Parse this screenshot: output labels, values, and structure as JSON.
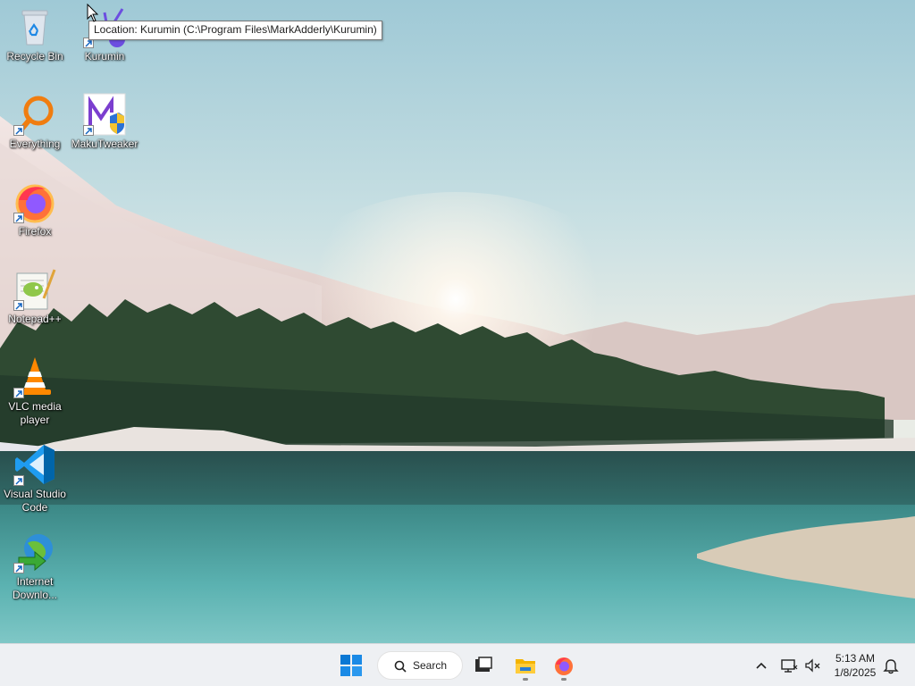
{
  "desktop": {
    "icons": [
      {
        "label": "Recycle Bin",
        "icon": "recycle-bin-icon"
      },
      {
        "label": "Kurumin",
        "icon": "kurumin-icon"
      },
      {
        "label": "Everything",
        "icon": "everything-search-icon"
      },
      {
        "label": "MakuTweaker",
        "icon": "makutweaker-icon"
      },
      {
        "label": "Firefox",
        "icon": "firefox-icon"
      },
      {
        "label": "Notepad++",
        "icon": "notepad-plus-plus-icon"
      },
      {
        "label": "VLC media player",
        "icon": "vlc-icon"
      },
      {
        "label": "Visual Studio Code",
        "icon": "vscode-icon"
      },
      {
        "label": "Internet Downlo...",
        "icon": "internet-download-manager-icon"
      }
    ],
    "tooltip": "Location: Kurumin (C:\\Program Files\\MarkAdderly\\Kurumin)"
  },
  "taskbar": {
    "search_label": "Search",
    "pinned": [
      "start-icon",
      "search",
      "task-view-icon",
      "file-explorer-icon",
      "firefox-icon"
    ],
    "time": "5:13 AM",
    "date": "1/8/2025"
  },
  "colors": {
    "taskbar_bg": "#eef0f3",
    "accent": "#0078d4"
  }
}
